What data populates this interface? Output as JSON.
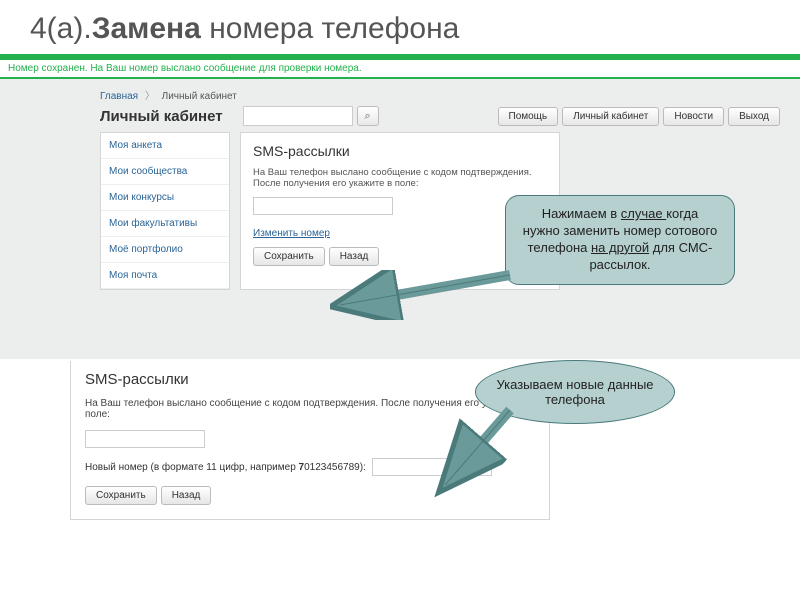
{
  "slide": {
    "title_prefix": "4(а).",
    "title_bold": "Замена",
    "title_rest": " номера телефона"
  },
  "banner": "Номер сохранен. На Ваш номер выслано сообщение для проверки номера.",
  "breadcrumb": {
    "home": "Главная",
    "current": "Личный кабинет"
  },
  "page_title": "Личный кабинет",
  "nav": {
    "help": "Помощь",
    "cabinet": "Личный кабинет",
    "news": "Новости",
    "exit": "Выход"
  },
  "sidebar": {
    "items": [
      "Моя анкета",
      "Мои сообщества",
      "Мои конкурсы",
      "Мои факультативы",
      "Моё портфолио",
      "Моя почта"
    ]
  },
  "panel1": {
    "title": "SMS-рассылки",
    "text": "На Ваш телефон выслано сообщение с кодом подтверждения. После получения его укажите в поле:",
    "change_link": "Изменить номер",
    "save": "Сохранить",
    "back": "Назад"
  },
  "panel2": {
    "title": "SMS-рассылки",
    "text": "На Ваш телефон выслано сообщение с кодом подтверждения. После получения его укажите в поле:",
    "new_label_before": "Новый номер (в формате 11 цифр, например ",
    "new_label_bold": "7",
    "new_label_after": "0123456789):",
    "save": "Сохранить",
    "back": "Назад"
  },
  "callout1": {
    "t1": "Нажимаем в ",
    "u1": "случае ",
    "t2": "когда нужно заменить номер сотового телефона ",
    "u2": "на другой",
    "t3": " для СМС-рассылок."
  },
  "callout2": "Указываем новые данные телефона"
}
